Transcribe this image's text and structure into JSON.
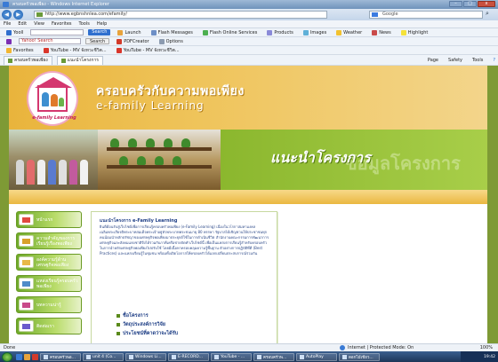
{
  "window": {
    "title": "ครอบครัวพอเพียง - Windows Internet Explorer",
    "minimize": "–",
    "maximize": "□",
    "close": "x"
  },
  "address_bar": {
    "url": "http://www.egbnshnlea.com/efamily/",
    "search_placeholder": "Google"
  },
  "menu": [
    "File",
    "Edit",
    "View",
    "Favorites",
    "Tools",
    "Help"
  ],
  "toolbar1": {
    "label": "Yooll",
    "search": "Search",
    "items": [
      "Launch",
      "Flash Messages",
      "Flash Online Services",
      "Products",
      "Images",
      "Weather",
      "News",
      "Highlight"
    ]
  },
  "toolbar2": {
    "input_value": "Yahoo! Search",
    "search": "Search",
    "pdf": "PDFCreator",
    "options": "Options"
  },
  "favorites_bar": {
    "label": "Favorites",
    "items": [
      "YouTube - MV จังหวะชีวิต...",
      "YouTube - MV จังหวะชีวิต..."
    ]
  },
  "tabs": {
    "items": [
      "ครอบครัวพอเพียง",
      "แนะนำโครงการ"
    ],
    "commands": [
      "Page",
      "Safety",
      "Tools"
    ]
  },
  "site": {
    "title": "ครอบครัวกับความพอเพียง",
    "subtitle": "e-family Learning",
    "logo_caption": "e-family Learning",
    "intro_heading": "แนะนำโครงการ",
    "intro_watermark": "ข้อมูลโครงการ"
  },
  "sidebar": [
    {
      "label": "หน้าแรก",
      "color": "#e1493f"
    },
    {
      "label": "ความสำคัญของการเรียนรู้เรื่องพอเพียง",
      "color": "#d9a12a"
    },
    {
      "label": "องค์ความรู้ด้านเศรษฐกิจพอเพียง",
      "color": "#e8b948"
    },
    {
      "label": "แหล่งเรียนรู้ครอบครัวพอเพียง",
      "color": "#4f8bc9"
    },
    {
      "label": "บทความน่ารู้",
      "color": "#c94a8a"
    },
    {
      "label": "ติดต่อเรา",
      "color": "#6a5acd"
    }
  ],
  "content": {
    "title": "แนะนำโครงการ e-Family Learning",
    "body": "ยินดีต้อนรับสู่เว็บไซต์เพื่อการเรียนรู้ครอบครัวพอเพียง (e-Family Learning) เนื่องในวโรกาสมหามงคล เฉลิมพระเกียรติพระบาทสมเด็จพระเจ้าอยู่หัวพระบาทพระชนมายุ 80 พรรษา รัฐบาลได้เชิญชวนให้ประชาชนทุกคนน้อมนำหลักปรัชญาของเศรษฐกิจพอเพียงมาประยุกต์ใช้ในการดำเนินชีวิต สำนักงานคณะกรรมการพัฒนาการเศรษฐกิจและสังคมแห่งชาติจึงได้ร่วมกับภาคีเครือข่ายจัดทำเว็บไซต์นี้ เพื่อเป็นแหล่งการเรียนรู้สำหรับครอบครัวในการนำหลักเศรษฐกิจพอเพียงไปปรับใช้ โดยมีเนื้อหาครอบคลุมความรู้พื้นฐาน ตัวอย่างการปฏิบัติที่ดี (Best Practices) และแหล่งเรียนรู้ในชุมชน พร้อมทั้งเปิดโอกาสให้ครอบครัวได้แลกเปลี่ยนประสบการณ์ร่วมกัน",
    "links": [
      "ชื่อโครงการ",
      "วัตถุประสงค์การวิจัย",
      "ประโยชน์ที่คาดว่าจะได้รับ"
    ]
  },
  "status_bar": {
    "left": "Done",
    "zone": "Internet | Protected Mode: On",
    "zoom": "100%"
  },
  "taskbar": {
    "items": [
      "ครอบครัวพอ...",
      "unit 4 (Co...",
      "Windows Li...",
      "E-RECORD...",
      "YouTube - ...",
      "ครอบครัวพ...",
      "AutoPlay",
      "ดอกไม้เขียว..."
    ],
    "clock": "19:42"
  }
}
